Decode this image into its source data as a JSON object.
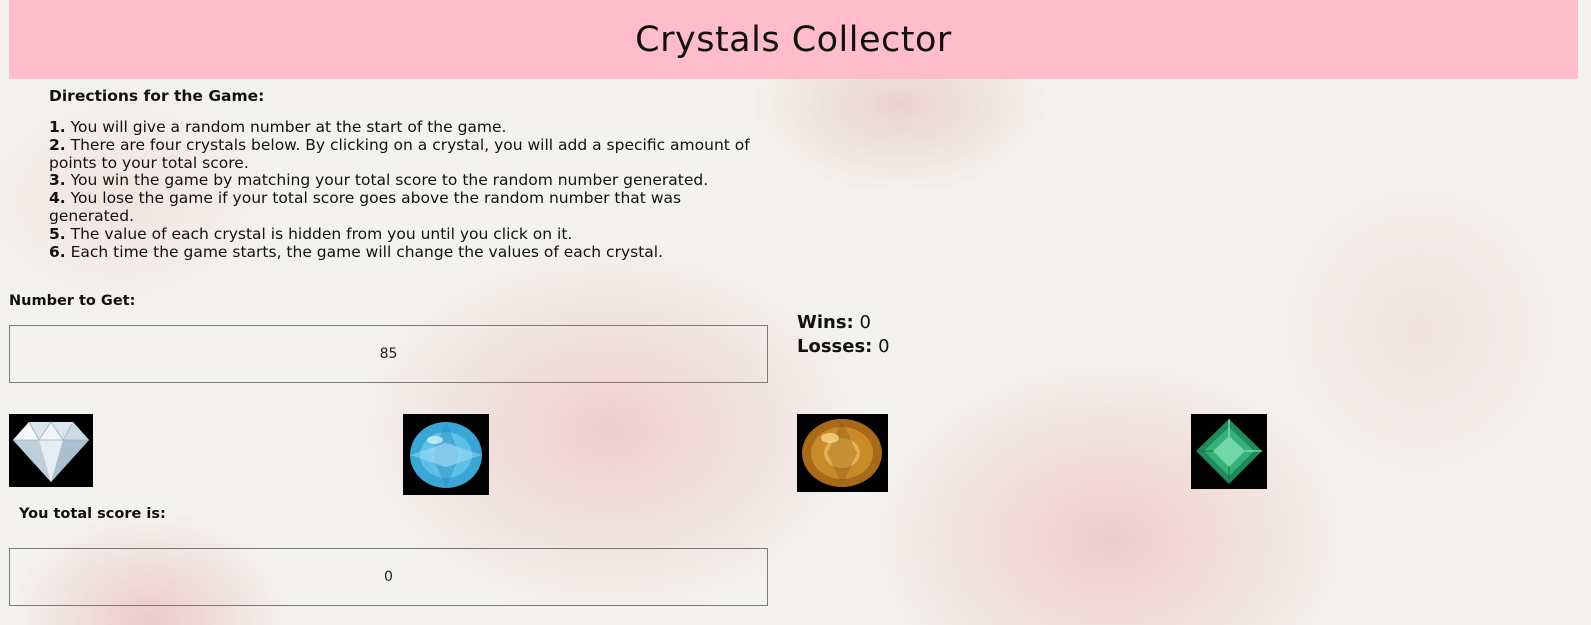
{
  "header": {
    "title": "Crystals Collector"
  },
  "directions": {
    "heading": "Directions for the Game:",
    "items": [
      {
        "num": "1.",
        "text": " You will give a random number at the start of the game."
      },
      {
        "num": "2.",
        "text": " There are four crystals below. By clicking on a crystal, you will add a specific amount of points to your total score."
      },
      {
        "num": "3.",
        "text": " You win the game by matching your total score to the random number generated."
      },
      {
        "num": "4.",
        "text": " You lose the game if your total score goes above the random number that was generated."
      },
      {
        "num": "5.",
        "text": " The value of each crystal is hidden from you until you click on it."
      },
      {
        "num": "6.",
        "text": " Each time the game starts, the game will change the values of each crystal."
      }
    ]
  },
  "target": {
    "label": "Number to Get:",
    "value": "85"
  },
  "stats": {
    "wins_label": "Wins:",
    "wins": "0",
    "losses_label": "Losses:",
    "losses": "0"
  },
  "crystals": [
    {
      "icon": "clear-diamond-crystal-icon",
      "color": "#d8e6ee"
    },
    {
      "icon": "blue-topaz-crystal-icon",
      "color": "#3aa6d6"
    },
    {
      "icon": "amber-citrine-crystal-icon",
      "color": "#c98a2a"
    },
    {
      "icon": "green-emerald-crystal-icon",
      "color": "#35b27a"
    }
  ],
  "score": {
    "label": "You total score is:",
    "value": "0"
  },
  "colors": {
    "header_bg": "#ffbccb",
    "page_bg": "#f3f2ee"
  }
}
